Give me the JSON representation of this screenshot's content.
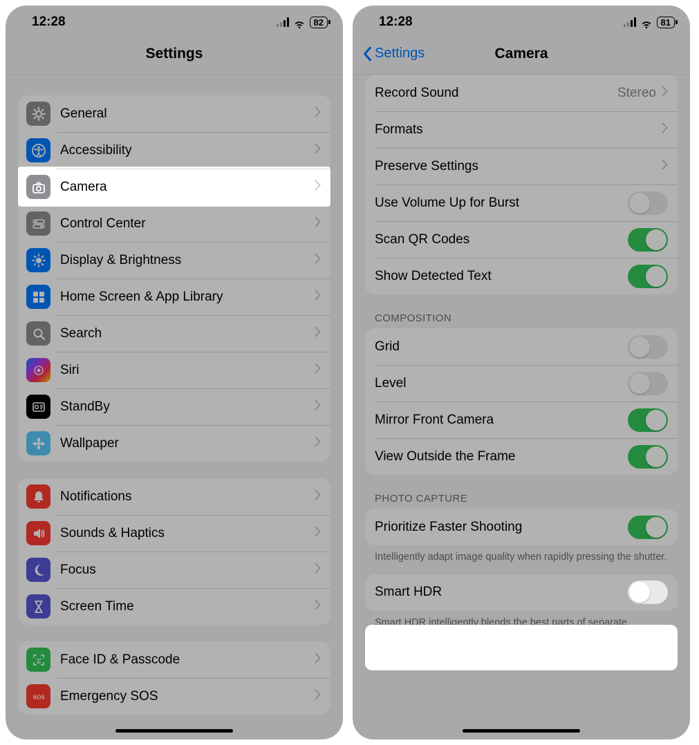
{
  "left": {
    "status": {
      "time": "12:28",
      "battery": "82"
    },
    "title": "Settings",
    "groups": [
      [
        {
          "id": "general",
          "label": "General",
          "icon": "gear",
          "bg": "ic-gray"
        },
        {
          "id": "accessibility",
          "label": "Accessibility",
          "icon": "accessibility",
          "bg": "ic-blue"
        },
        {
          "id": "camera",
          "label": "Camera",
          "icon": "camera",
          "bg": "ic-gray",
          "highlight": true
        },
        {
          "id": "control-center",
          "label": "Control Center",
          "icon": "switches",
          "bg": "ic-gray"
        },
        {
          "id": "display",
          "label": "Display & Brightness",
          "icon": "sun",
          "bg": "ic-blue"
        },
        {
          "id": "home-screen",
          "label": "Home Screen & App Library",
          "icon": "apps",
          "bg": "ic-blue"
        },
        {
          "id": "search",
          "label": "Search",
          "icon": "search",
          "bg": "ic-gray"
        },
        {
          "id": "siri",
          "label": "Siri",
          "icon": "siri",
          "bg": "ic-siri"
        },
        {
          "id": "standby",
          "label": "StandBy",
          "icon": "standby",
          "bg": "ic-black"
        },
        {
          "id": "wallpaper",
          "label": "Wallpaper",
          "icon": "flower",
          "bg": "ic-teal"
        }
      ],
      [
        {
          "id": "notifications",
          "label": "Notifications",
          "icon": "bell",
          "bg": "ic-red"
        },
        {
          "id": "sounds",
          "label": "Sounds & Haptics",
          "icon": "speaker",
          "bg": "ic-red"
        },
        {
          "id": "focus",
          "label": "Focus",
          "icon": "moon",
          "bg": "ic-purple"
        },
        {
          "id": "screen-time",
          "label": "Screen Time",
          "icon": "hourglass",
          "bg": "ic-purple"
        }
      ],
      [
        {
          "id": "faceid",
          "label": "Face ID & Passcode",
          "icon": "faceid",
          "bg": "ic-green"
        },
        {
          "id": "sos",
          "label": "Emergency SOS",
          "icon": "sos",
          "bg": "ic-red"
        }
      ]
    ]
  },
  "right": {
    "status": {
      "time": "12:28",
      "battery": "81"
    },
    "back": "Settings",
    "title": "Camera",
    "group1": [
      {
        "id": "record-sound",
        "label": "Record Sound",
        "value": "Stereo",
        "type": "link"
      },
      {
        "id": "formats",
        "label": "Formats",
        "type": "link"
      },
      {
        "id": "preserve",
        "label": "Preserve Settings",
        "type": "link"
      },
      {
        "id": "burst",
        "label": "Use Volume Up for Burst",
        "type": "toggle",
        "on": false
      },
      {
        "id": "qr",
        "label": "Scan QR Codes",
        "type": "toggle",
        "on": true
      },
      {
        "id": "detected-text",
        "label": "Show Detected Text",
        "type": "toggle",
        "on": true
      }
    ],
    "section2_header": "COMPOSITION",
    "group2": [
      {
        "id": "grid",
        "label": "Grid",
        "type": "toggle",
        "on": false
      },
      {
        "id": "level",
        "label": "Level",
        "type": "toggle",
        "on": false
      },
      {
        "id": "mirror",
        "label": "Mirror Front Camera",
        "type": "toggle",
        "on": true
      },
      {
        "id": "view-outside",
        "label": "View Outside the Frame",
        "type": "toggle",
        "on": true
      }
    ],
    "section3_header": "PHOTO CAPTURE",
    "group3_a": [
      {
        "id": "faster",
        "label": "Prioritize Faster Shooting",
        "type": "toggle",
        "on": true
      }
    ],
    "footer3a": "Intelligently adapt image quality when rapidly pressing the shutter.",
    "group3_b": [
      {
        "id": "smart-hdr",
        "label": "Smart HDR",
        "type": "toggle",
        "on": false,
        "highlight": true
      }
    ],
    "footer3b": "Smart HDR intelligently blends the best parts of separate exposures into a single photo."
  }
}
